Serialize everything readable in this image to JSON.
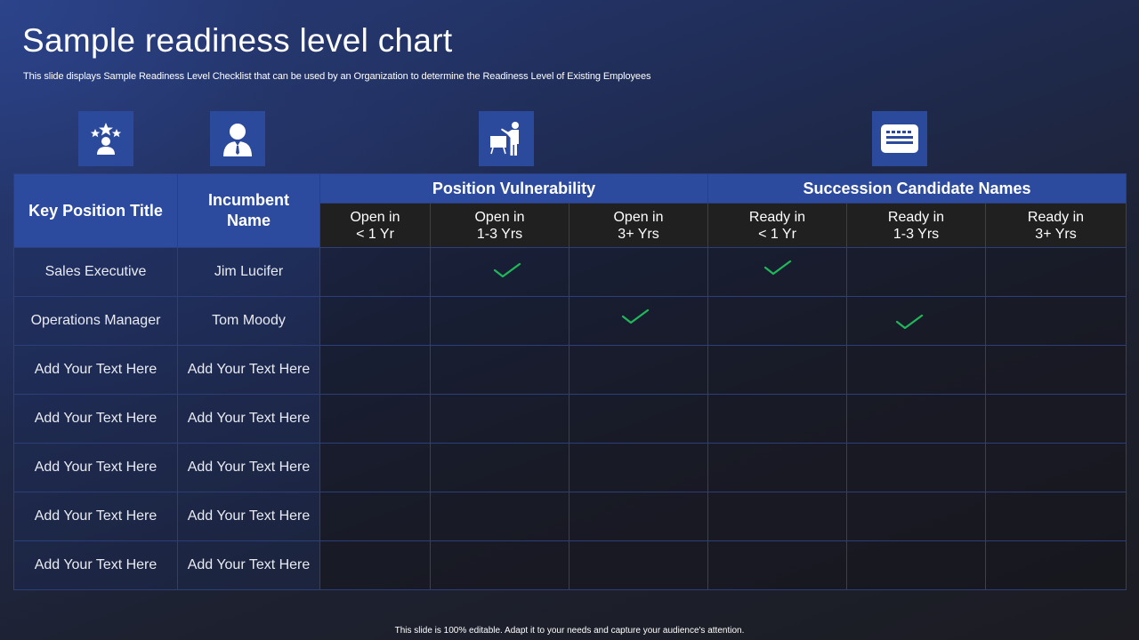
{
  "title": "Sample readiness level chart",
  "subtitle": "This slide displays Sample Readiness Level Checklist that can be used by an Organization to determine the Readiness Level of Existing Employees",
  "icons": [
    "award-person-icon",
    "businessman-icon",
    "presenter-icon",
    "keyboard-icon"
  ],
  "table": {
    "col1_header": "Key Position Title",
    "col2_header": "Incumbent Name",
    "group1_header": "Position Vulnerability",
    "group2_header": "Succession Candidate Names",
    "sub_headers": [
      "Open in\n< 1 Yr",
      "Open in\n1-3 Yrs",
      "Open in\n3+ Yrs",
      "Ready in\n< 1 Yr",
      "Ready in\n1-3 Yrs",
      "Ready in\n3+ Yrs"
    ],
    "rows": [
      {
        "position": "Sales Executive",
        "name": "Jim Lucifer",
        "checks": [
          false,
          true,
          false,
          true,
          false,
          false
        ]
      },
      {
        "position": "Operations Manager",
        "name": "Tom Moody",
        "checks": [
          false,
          false,
          true,
          false,
          true,
          false
        ]
      },
      {
        "position": "Add Your Text Here",
        "name": "Add Your Text Here",
        "checks": [
          false,
          false,
          false,
          false,
          false,
          false
        ]
      },
      {
        "position": "Add Your Text Here",
        "name": "Add Your Text Here",
        "checks": [
          false,
          false,
          false,
          false,
          false,
          false
        ]
      },
      {
        "position": "Add Your Text Here",
        "name": "Add Your Text Here",
        "checks": [
          false,
          false,
          false,
          false,
          false,
          false
        ]
      },
      {
        "position": "Add Your Text Here",
        "name": "Add Your Text Here",
        "checks": [
          false,
          false,
          false,
          false,
          false,
          false
        ]
      },
      {
        "position": "Add Your Text Here",
        "name": "Add Your Text Here",
        "checks": [
          false,
          false,
          false,
          false,
          false,
          false
        ]
      }
    ]
  },
  "footer": "This slide is 100% editable.  Adapt it to your needs and capture your audience's attention.",
  "colors": {
    "header_blue": "#2d4b9e",
    "subheader_dark": "#202020",
    "check_green": "#1fb85a",
    "icon_tile": "#2c4a9c"
  }
}
